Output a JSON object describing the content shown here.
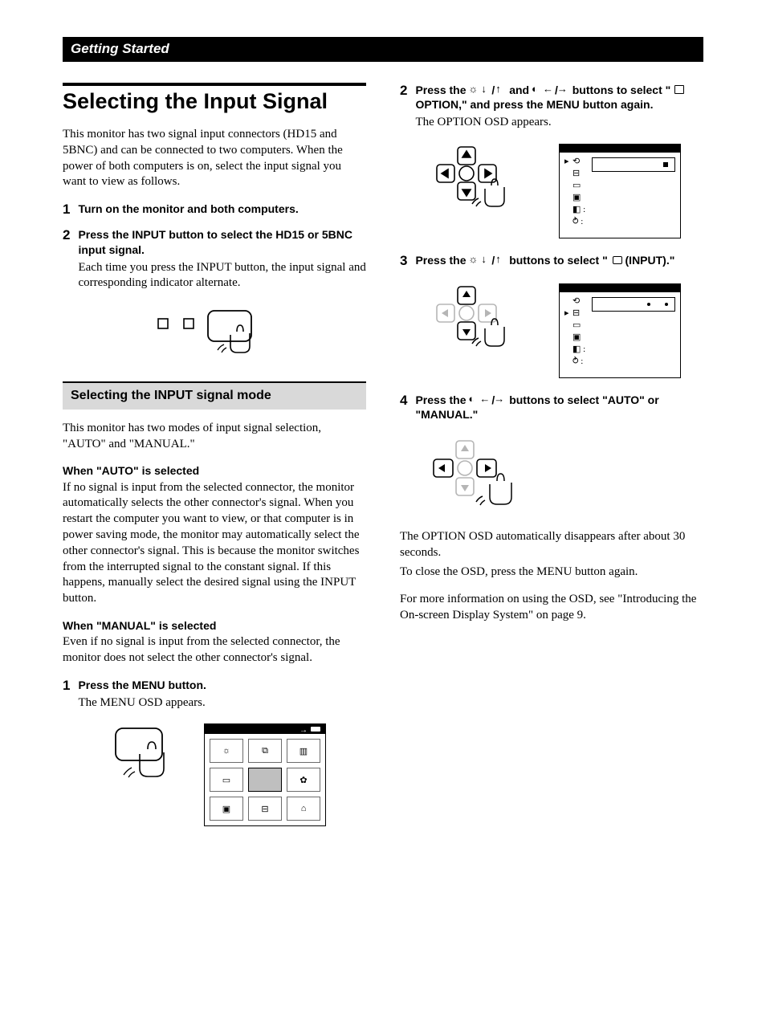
{
  "banner": "Getting Started",
  "title": "Selecting the Input Signal",
  "intro": "This monitor has two signal input connectors (HD15 and 5BNC) and can be connected to two computers. When the power of both computers is on, select the input signal you want to view as follows.",
  "stepsA": [
    {
      "num": "1",
      "head": "Turn on the monitor and both computers."
    },
    {
      "num": "2",
      "head": "Press the INPUT button to select the HD15 or 5BNC input signal.",
      "note": "Each time you press the INPUT button, the input signal and corresponding indicator alternate."
    }
  ],
  "subsection": "Selecting the INPUT signal mode",
  "sub_intro": "This monitor has two modes of input signal selection, \"AUTO\" and \"MANUAL.\"",
  "auto_head": "When \"AUTO\" is selected",
  "auto_body": "If no signal is input from the selected connector, the monitor automatically selects the other connector's signal. When you restart the computer you want to view, or that computer is in power saving mode, the monitor may automatically select the other connector's signal.  This is because the monitor switches from the interrupted signal to the constant signal. If this happens, manually select the desired signal using the INPUT button.",
  "manual_head": "When \"MANUAL\" is selected",
  "manual_body": "Even if no signal is input from the selected connector, the monitor does not select the other connector's signal.",
  "stepB1": {
    "num": "1",
    "head": "Press the MENU button.",
    "note": "The MENU OSD appears."
  },
  "right": {
    "step2_num": "2",
    "step2_a": "Press the ",
    "step2_b": " and ",
    "step2_c": " buttons to select \" ",
    "step2_d": "OPTION,\" and press the MENU button again.",
    "step2_note": "The OPTION OSD appears.",
    "step3_num": "3",
    "step3_a": "Press the ",
    "step3_b": " buttons to select \" ",
    "step3_c": " (INPUT).\"",
    "step4_num": "4",
    "step4_a": "Press the ",
    "step4_b": " buttons to select \"AUTO\" or \"MANUAL.\"",
    "tail1": "The OPTION OSD automatically disappears after about 30 seconds.",
    "tail2": "To close the OSD, press the MENU button again.",
    "tail3": "For more information on using the OSD, see \"Introducing the On-screen Display System\" on page 9."
  }
}
